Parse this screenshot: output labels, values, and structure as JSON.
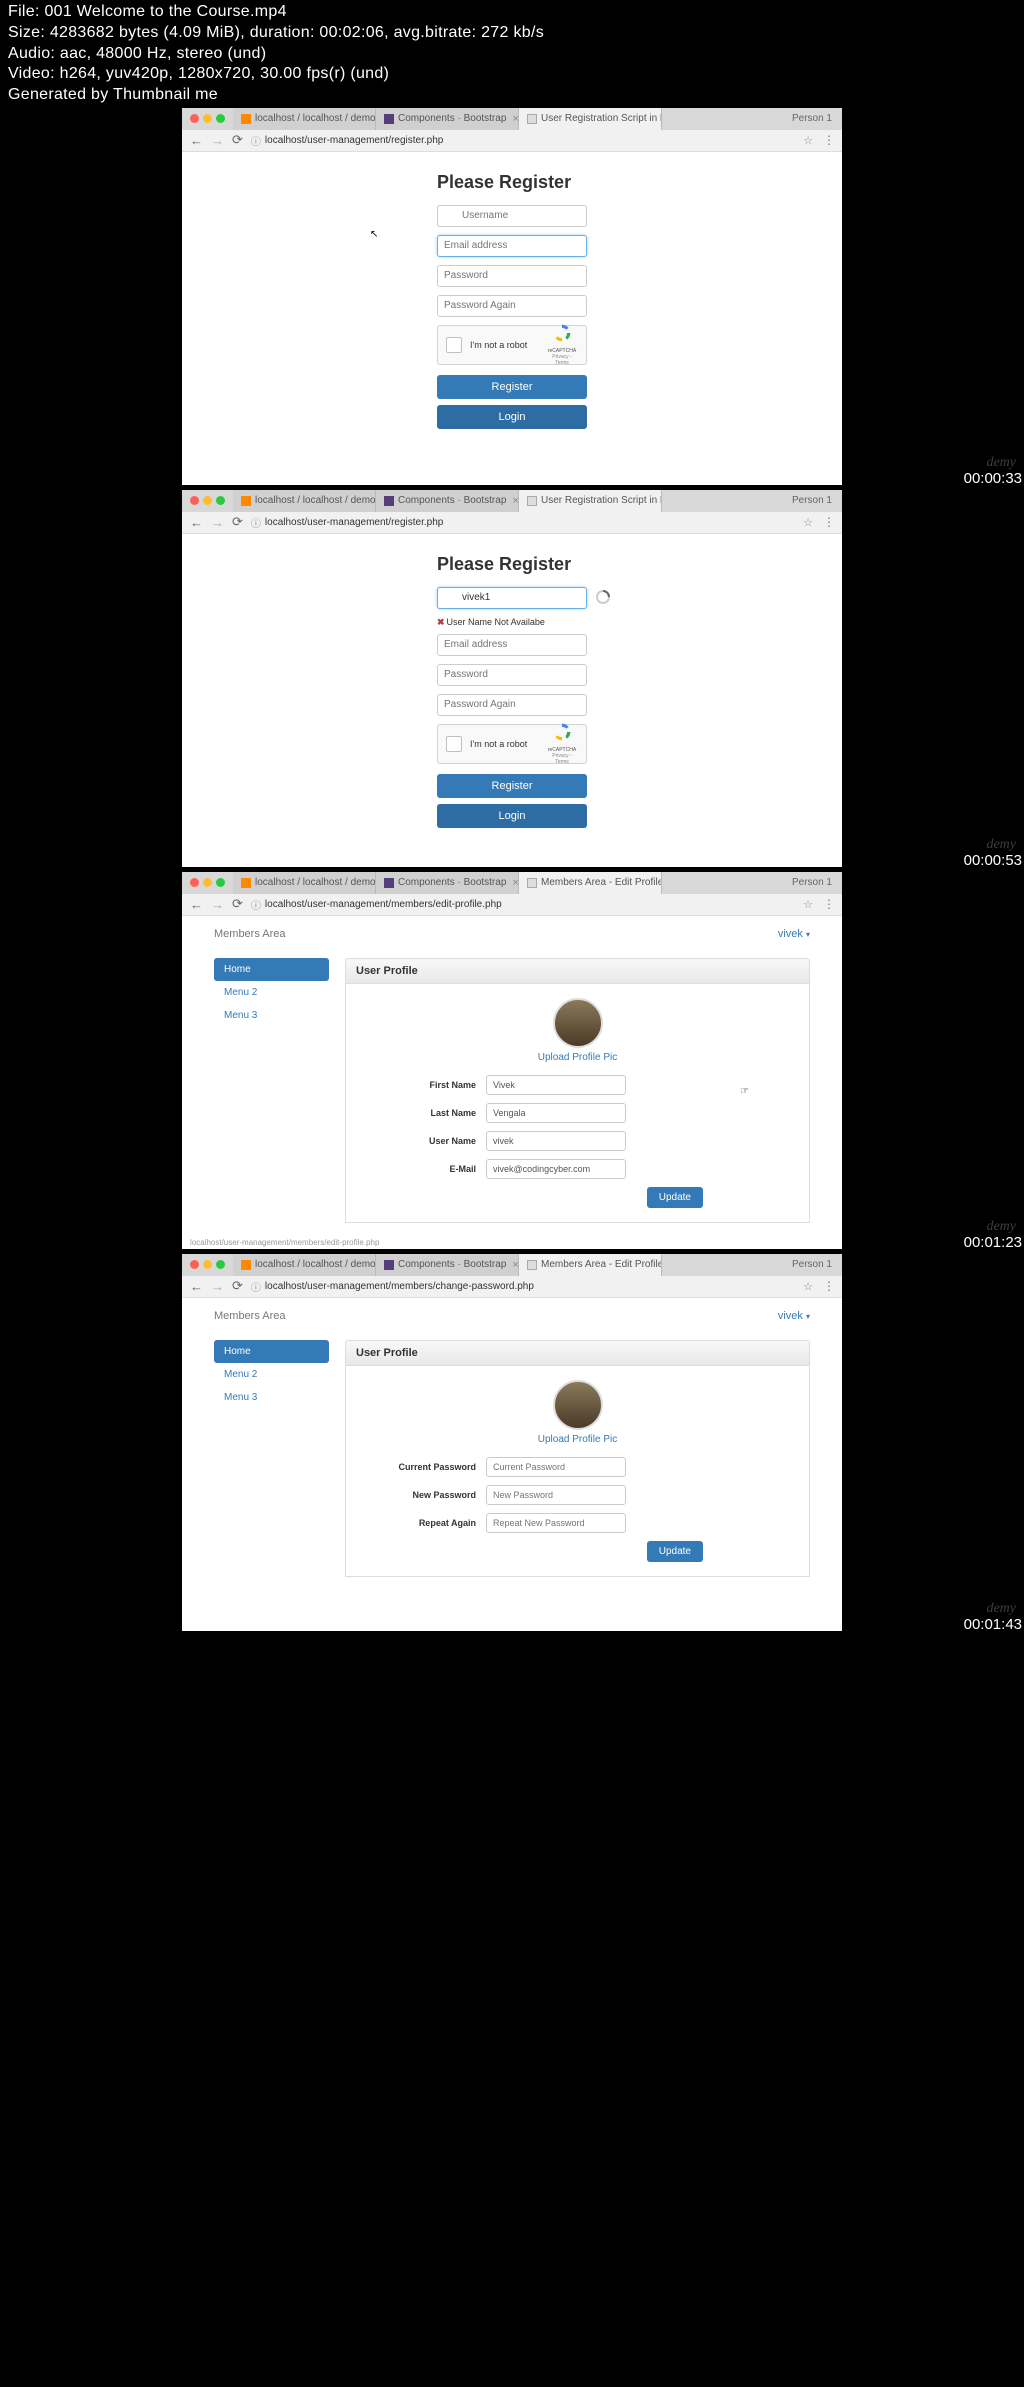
{
  "metadata": {
    "file": "File: 001 Welcome to the Course.mp4",
    "size": "Size: 4283682 bytes (4.09 MiB), duration: 00:02:06, avg.bitrate: 272 kb/s",
    "audio": "Audio: aac, 48000 Hz, stereo (und)",
    "video": "Video: h264, yuv420p, 1280x720, 30.00 fps(r) (und)",
    "generated": "Generated by Thumbnail me"
  },
  "tabs": [
    {
      "label": "localhost / localhost / demo |",
      "icon": "phpmyadmin"
    },
    {
      "label": "Components · Bootstrap",
      "icon": "bootstrap"
    },
    {
      "label": "User Registration Script in PH",
      "icon": "page"
    },
    {
      "label": "Members Area - Edit Profile",
      "icon": "page"
    }
  ],
  "person": "Person 1",
  "urls": {
    "register": "localhost/user-management/register.php",
    "editProfile": "localhost/user-management/members/edit-profile.php",
    "changePassword": "localhost/user-management/members/change-password.php"
  },
  "register": {
    "title": "Please Register",
    "username_placeholder": "Username",
    "username_value": "vivek1",
    "username_error": "User Name Not Availabe",
    "email_placeholder": "Email address",
    "password_placeholder": "Password",
    "password2_placeholder": "Password Again",
    "captcha": "I'm not a robot",
    "captcha_brand": "reCAPTCHA",
    "captcha_privacy": "Privacy - Terms",
    "register_btn": "Register",
    "login_btn": "Login"
  },
  "members": {
    "area": "Members Area",
    "user": "vivek",
    "sidebar": [
      {
        "label": "Home",
        "active": true
      },
      {
        "label": "Menu 2",
        "active": false
      },
      {
        "label": "Menu 3",
        "active": false
      }
    ],
    "panel_title": "User Profile",
    "upload": "Upload Profile Pic",
    "profile": {
      "firstName": {
        "label": "First Name",
        "value": "Vivek"
      },
      "lastName": {
        "label": "Last Name",
        "value": "Vengala"
      },
      "userName": {
        "label": "User Name",
        "value": "vivek"
      },
      "email": {
        "label": "E-Mail",
        "value": "vivek@codingcyber.com"
      }
    },
    "password": {
      "current": {
        "label": "Current Password",
        "placeholder": "Current Password"
      },
      "new": {
        "label": "New Password",
        "placeholder": "New Password"
      },
      "repeat": {
        "label": "Repeat Again",
        "placeholder": "Repeat New Password"
      }
    },
    "update_btn": "Update"
  },
  "timestamps": [
    "00:00:33",
    "00:00:53",
    "00:01:23",
    "00:01:43"
  ],
  "status_bar": "localhost/user-management/members/edit-profile.php",
  "watermark": "demy"
}
